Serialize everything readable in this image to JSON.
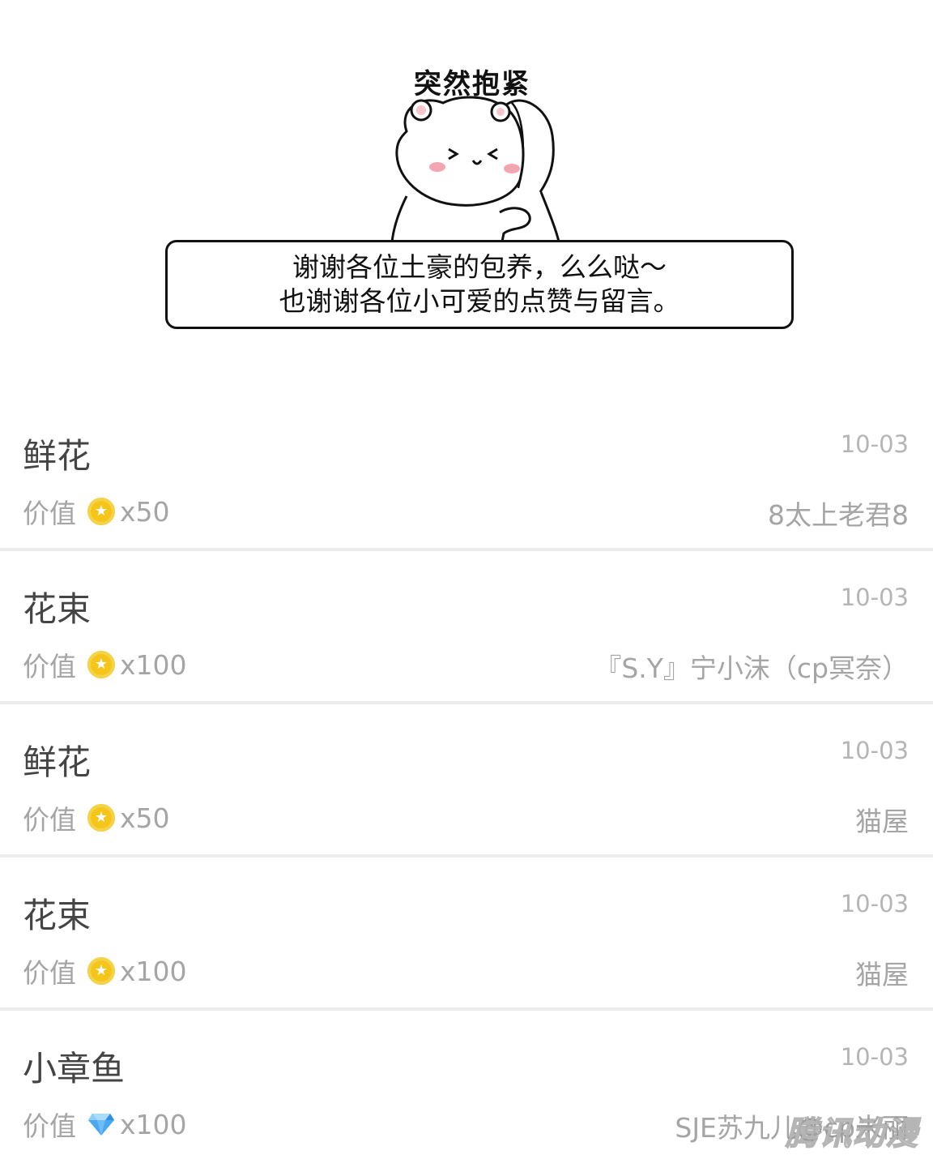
{
  "sticker": {
    "caption": "突然抱紧"
  },
  "bubble": {
    "line1": "谢谢各位土豪的包养，么么哒～",
    "line2": "也谢谢各位小可爱的点赞与留言。"
  },
  "gifts": [
    {
      "name": "鲜花",
      "date": "10-03",
      "value_label": "价值",
      "currency_icon": "coin-icon",
      "amount": "x50",
      "sender": "8太上老君8"
    },
    {
      "name": "花束",
      "date": "10-03",
      "value_label": "价值",
      "currency_icon": "coin-icon",
      "amount": "x100",
      "sender": "『S.Y』宁小沫（cp冥奈）"
    },
    {
      "name": "鲜花",
      "date": "10-03",
      "value_label": "价值",
      "currency_icon": "coin-icon",
      "amount": "x50",
      "sender": "猫屋"
    },
    {
      "name": "花束",
      "date": "10-03",
      "value_label": "价值",
      "currency_icon": "coin-icon",
      "amount": "x100",
      "sender": "猫屋"
    },
    {
      "name": "小章鱼",
      "date": "10-03",
      "value_label": "价值",
      "currency_icon": "diamond-icon",
      "amount": "x100",
      "sender": "SJE苏九儿@cp米丽"
    }
  ],
  "watermark": "腾讯动漫",
  "colors": {
    "coin": "#f6c519",
    "diamond": "#4aa8f0",
    "muted_text": "#a5a5a5",
    "divider": "#ececec"
  }
}
